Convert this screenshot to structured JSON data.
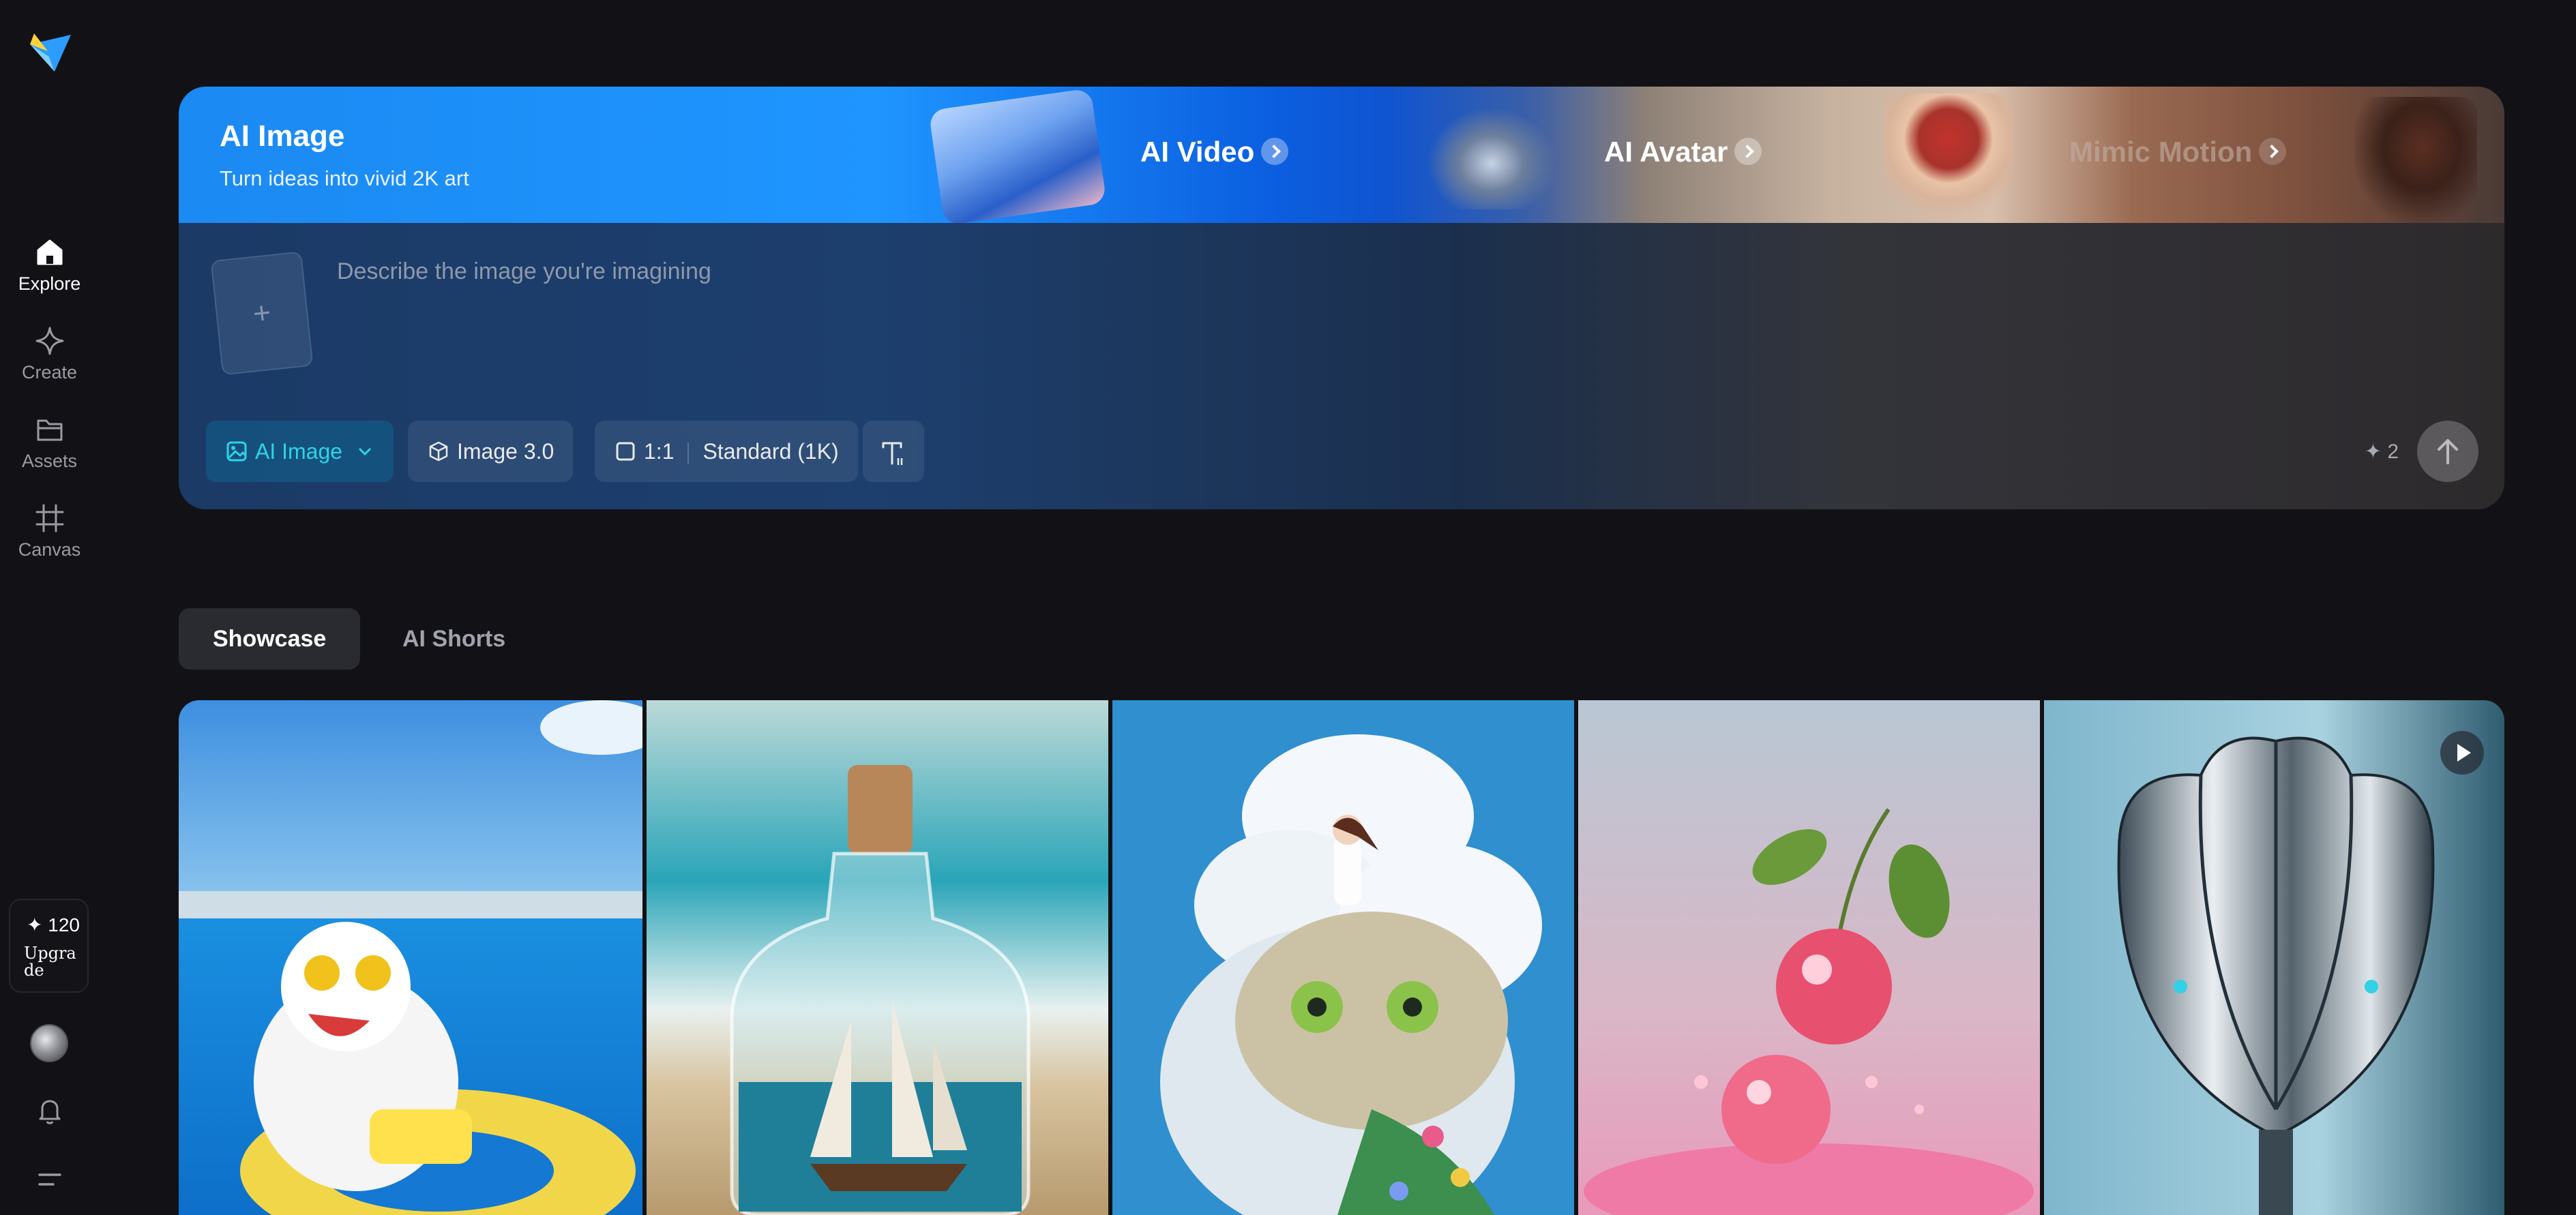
{
  "sidebar": {
    "nav": [
      {
        "label": "Explore",
        "icon": "home-icon",
        "active": true
      },
      {
        "label": "Create",
        "icon": "sparkle-icon",
        "active": false
      },
      {
        "label": "Assets",
        "icon": "folder-icon",
        "active": false
      },
      {
        "label": "Canvas",
        "icon": "crop-icon",
        "active": false
      }
    ],
    "credits": "✦ 120",
    "upgrade_label": "Upgrade"
  },
  "hero": {
    "title": "AI Image",
    "subtitle": "Turn ideas into vivid 2K art",
    "links": [
      "AI Video",
      "AI Avatar",
      "Mimic Motion"
    ],
    "prompt_placeholder": "Describe the image you're imagining",
    "upload_icon": "plus-icon",
    "mode_label": "AI Image",
    "model_label": "Image 3.0",
    "ratio_label": "1:1",
    "quality_label": "Standard (1K)",
    "cost_label": "✦ 2"
  },
  "tabs": [
    "Showcase",
    "AI Shorts"
  ],
  "gallery": {
    "items": [
      {
        "subject": "cat-sunglasses-pool"
      },
      {
        "subject": "ship-in-bottle"
      },
      {
        "subject": "girl-on-cat-clouds"
      },
      {
        "subject": "cherries-splash"
      },
      {
        "subject": "chrome-tulip",
        "video": true
      }
    ]
  },
  "colors": {
    "accent": "#2ED3E6",
    "background": "#121216",
    "banner_blue": "#1F95FF"
  }
}
